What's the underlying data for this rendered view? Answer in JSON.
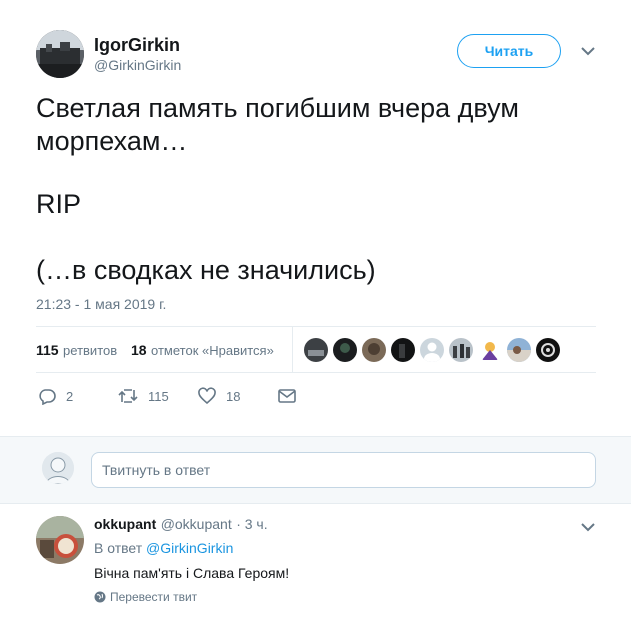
{
  "author": {
    "name": "IgorGirkin",
    "handle": "@GirkinGirkin"
  },
  "follow_button": "Читать",
  "tweet": {
    "line1": "Светлая память погибшим вчера двум морпехам…",
    "line2": "RIP",
    "line3": "(…в сводках не значились)",
    "timestamp": "21:23 - 1 мая 2019 г."
  },
  "stats": {
    "retweets_count": "115",
    "retweets_label": "ретвитов",
    "likes_count": "18",
    "likes_label": "отметок «Нравится»"
  },
  "actions": {
    "reply_count": "2",
    "retweet_count": "115",
    "like_count": "18"
  },
  "reply_input": {
    "placeholder": "Твитнуть в ответ"
  },
  "reply": {
    "name": "okkupant",
    "handle": "@okkupant",
    "time": "· 3 ч.",
    "in_reply_prefix": "В ответ",
    "in_reply_handle": "@GirkinGirkin",
    "text": "Вічна пам'ять і Слава Героям!",
    "translate": "Перевести твит"
  },
  "colors": {
    "accent": "#1da1f2",
    "muted": "#657786",
    "border": "#e6ecf0"
  }
}
